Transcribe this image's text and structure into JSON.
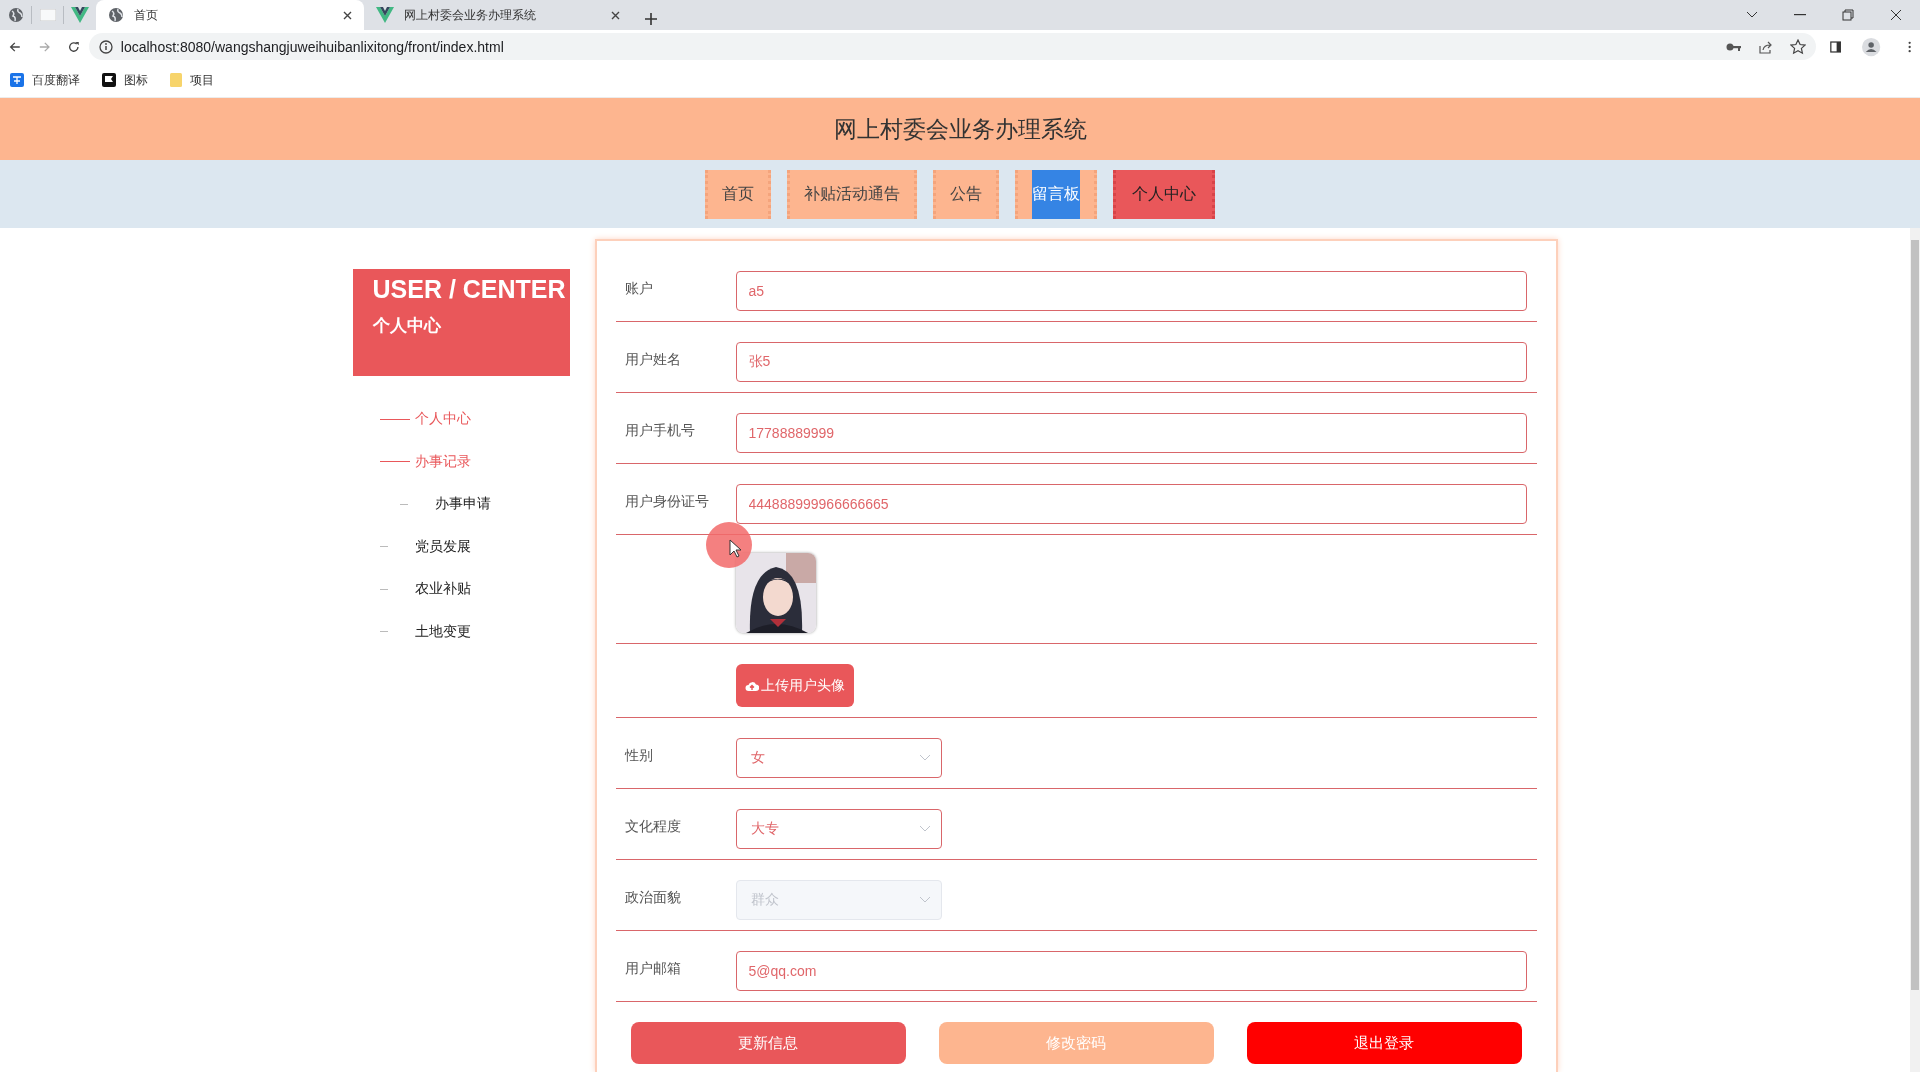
{
  "browser": {
    "tabs": [
      {
        "title": "首页",
        "selected": true
      },
      {
        "title": "网上村委会业务办理系统",
        "selected": false
      }
    ],
    "url": "localhost:8080/wangshangjuweihuibanlixitong/front/index.html",
    "bookmarks": [
      "百度翻译",
      "图标",
      "项目"
    ]
  },
  "header": {
    "title": "网上村委会业务办理系统"
  },
  "nav": [
    {
      "label": "首页",
      "selected": false,
      "highlighted": false
    },
    {
      "label": "补贴活动通告",
      "selected": false,
      "highlighted": false
    },
    {
      "label": "公告",
      "selected": false,
      "highlighted": false
    },
    {
      "label": "留言板",
      "selected": false,
      "highlighted": true
    },
    {
      "label": "个人中心",
      "selected": true,
      "highlighted": false
    }
  ],
  "sidebar": {
    "title": "USER / CENTER",
    "subtitle": "个人中心",
    "items": [
      {
        "label": "个人中心",
        "selected": true
      },
      {
        "label": "办事记录",
        "selected": true,
        "children": [
          {
            "label": "办事申请",
            "selected": false
          }
        ]
      },
      {
        "label": "党员发展",
        "selected": false
      },
      {
        "label": "农业补贴",
        "selected": false
      },
      {
        "label": "土地变更",
        "selected": false
      }
    ]
  },
  "form": {
    "rows": [
      {
        "kind": "text",
        "label": "账户",
        "value": "a5"
      },
      {
        "kind": "text",
        "label": "用户姓名",
        "value": "张5"
      },
      {
        "kind": "text",
        "label": "用户手机号",
        "value": "17788889999"
      },
      {
        "kind": "text",
        "label": "用户身份证号",
        "value": "444888999966666665"
      },
      {
        "kind": "avatar"
      },
      {
        "kind": "upload",
        "button": "上传用户头像"
      },
      {
        "kind": "select",
        "label": "性别",
        "value": "女",
        "disabled": false
      },
      {
        "kind": "select",
        "label": "文化程度",
        "value": "大专",
        "disabled": false
      },
      {
        "kind": "select",
        "label": "政治面貌",
        "value": "群众",
        "disabled": true
      },
      {
        "kind": "text",
        "label": "用户邮箱",
        "value": "5@qq.com"
      }
    ],
    "buttons": [
      {
        "label": "更新信息",
        "color": "#e9575a"
      },
      {
        "label": "修改密码",
        "color": "#fdb58f"
      },
      {
        "label": "退出登录",
        "color": "#ff0000"
      }
    ]
  }
}
